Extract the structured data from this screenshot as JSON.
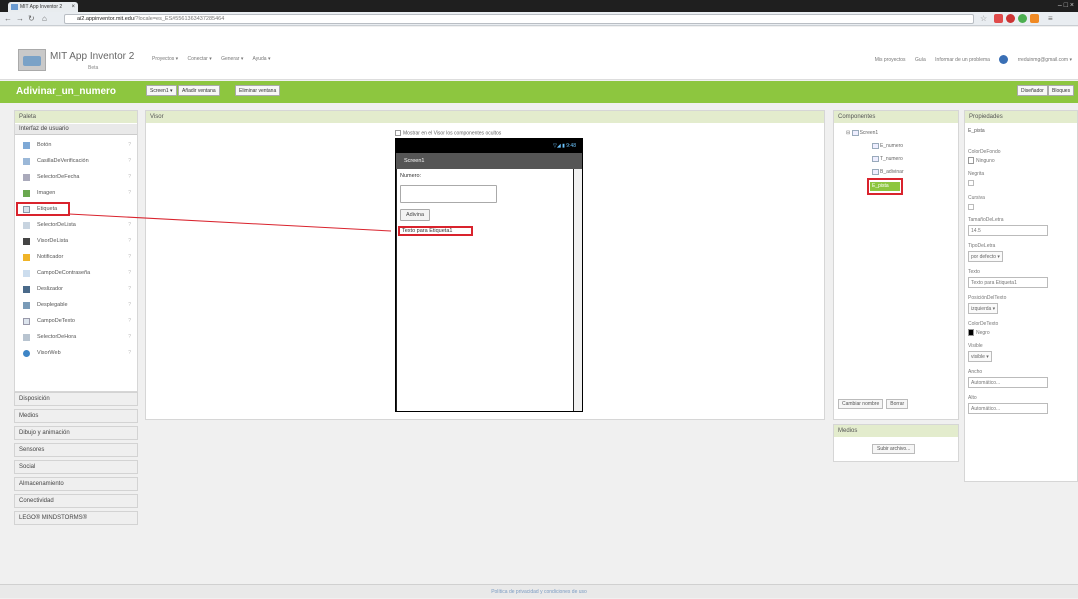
{
  "browser": {
    "tab_title": "MIT App Inventor 2",
    "url_prefix": "ai2.appinventor.mit.edu",
    "url_suffix": "/?locale=es_ES#5561363437285464"
  },
  "header": {
    "brand": "MIT App Inventor 2",
    "beta": "Beta",
    "menu": [
      "Proyectos ▾",
      "Conectar ▾",
      "Generar ▾",
      "Ayuda ▾"
    ],
    "right_menu": [
      "Mis proyectos",
      "Guía",
      "Informar de un problema",
      "rreduinmg@gmail.com ▾"
    ]
  },
  "toolbar": {
    "project_name": "Adivinar_un_numero",
    "screen_button": "Screen1 ▾",
    "add_screen": "Añadir ventana",
    "remove_screen": "Eliminar ventana",
    "designer": "Diseñador",
    "blocks": "Bloques"
  },
  "palette": {
    "title": "Paleta",
    "section": "Interfaz de usuario",
    "items": [
      {
        "label": "Botón",
        "icon": "button-icon"
      },
      {
        "label": "CasillaDeVerificación",
        "icon": "checkbox-icon"
      },
      {
        "label": "SelectorDeFecha",
        "icon": "date-picker-icon"
      },
      {
        "label": "Imagen",
        "icon": "image-icon"
      },
      {
        "label": "Etiqueta",
        "icon": "label-icon"
      },
      {
        "label": "SelectorDeLista",
        "icon": "list-picker-icon"
      },
      {
        "label": "VisorDeLista",
        "icon": "list-view-icon"
      },
      {
        "label": "Notificador",
        "icon": "notifier-icon"
      },
      {
        "label": "CampoDeContraseña",
        "icon": "password-icon"
      },
      {
        "label": "Deslizador",
        "icon": "slider-icon"
      },
      {
        "label": "Desplegable",
        "icon": "spinner-icon"
      },
      {
        "label": "CampoDeTexto",
        "icon": "textbox-icon"
      },
      {
        "label": "SelectorDeHora",
        "icon": "time-picker-icon"
      },
      {
        "label": "VisorWeb",
        "icon": "web-viewer-icon"
      }
    ],
    "help_mark": "?",
    "drawers": [
      "Disposición",
      "Medios",
      "Dibujo y animación",
      "Sensores",
      "Social",
      "Almacenamiento",
      "Conectividad",
      "LEGO® MINDSTORMS®"
    ]
  },
  "viewer": {
    "title": "Visor",
    "checkbox_label": "Mostrar en el Visor los componentes ocultos",
    "phone_status": "▽◢ ▮ 9:48",
    "screen_title": "Screen1",
    "numero_label": "Numero:",
    "adivina_button": "Adivina",
    "etiqueta_text": "Texto para Etiqueta1"
  },
  "components": {
    "title": "Componentes",
    "tree": [
      "Screen1",
      "E_numero",
      "T_numero",
      "B_adivinar",
      "E_pista"
    ],
    "rename": "Cambiar nombre",
    "delete": "Borrar"
  },
  "media": {
    "title": "Medios",
    "upload": "Subir archivo..."
  },
  "properties": {
    "title": "Propiedades",
    "component": "E_pista",
    "color_fondo_label": "ColorDeFondo",
    "color_fondo_value": "Ninguno",
    "negrita_label": "Negrita",
    "cursiva_label": "Cursiva",
    "tamano_label": "TamañoDeLetra",
    "tamano_value": "14.5",
    "tipo_label": "TipoDeLetra",
    "tipo_value": "por defecto ▾",
    "texto_label": "Texto",
    "texto_value": "Texto para Etiqueta1",
    "posicion_label": "PosiciónDelTexto",
    "posicion_value": "izquierda ▾",
    "color_texto_label": "ColorDeTexto",
    "color_texto_value": "Negro",
    "visible_label": "Visible",
    "visible_value": "visible ▾",
    "ancho_label": "Ancho",
    "ancho_value": "Automático...",
    "alto_label": "Alto",
    "alto_value": "Automático..."
  },
  "footer": {
    "privacy": "Política de privacidad y condiciones de uso"
  },
  "colors": {
    "accent_green": "#8dc63f",
    "highlight_red": "#d9232d"
  }
}
